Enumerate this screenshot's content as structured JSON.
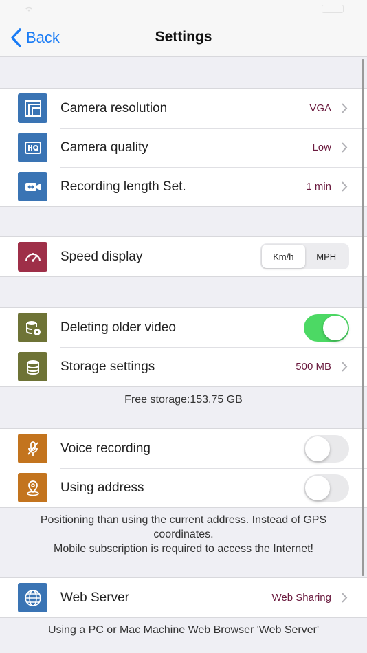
{
  "nav": {
    "back_label": "Back",
    "title": "Settings"
  },
  "camera_group": [
    {
      "label": "Camera resolution",
      "value": "VGA"
    },
    {
      "label": "Camera quality",
      "value": "Low"
    },
    {
      "label": "Recording length Set.",
      "value": "1 min"
    }
  ],
  "speed": {
    "label": "Speed display",
    "options": [
      "Km/h",
      "MPH"
    ],
    "selected": "Km/h"
  },
  "storage": {
    "deleting_label": "Deleting older video",
    "deleting_on": true,
    "storage_label": "Storage settings",
    "storage_value": "500 MB",
    "free_storage": "Free storage:153.75 GB"
  },
  "voice": {
    "voice_label": "Voice recording",
    "voice_on": false,
    "address_label": "Using address",
    "address_on": false,
    "note_line1": "Positioning than using the current address. Instead of GPS coordinates.",
    "note_line2": "Mobile subscription is required to access the Internet!"
  },
  "web": {
    "label": "Web Server",
    "value": "Web Sharing",
    "note": "Using a PC or Mac Machine Web Browser 'Web Server'"
  },
  "colors": {
    "accent": "#1a7cf5",
    "value_text": "#6b1b3f",
    "toggle_on": "#4cd964",
    "icon_blue": "#3a74b4",
    "icon_red": "#9e2f48",
    "icon_olive": "#6e7336",
    "icon_orange": "#c3741e"
  }
}
